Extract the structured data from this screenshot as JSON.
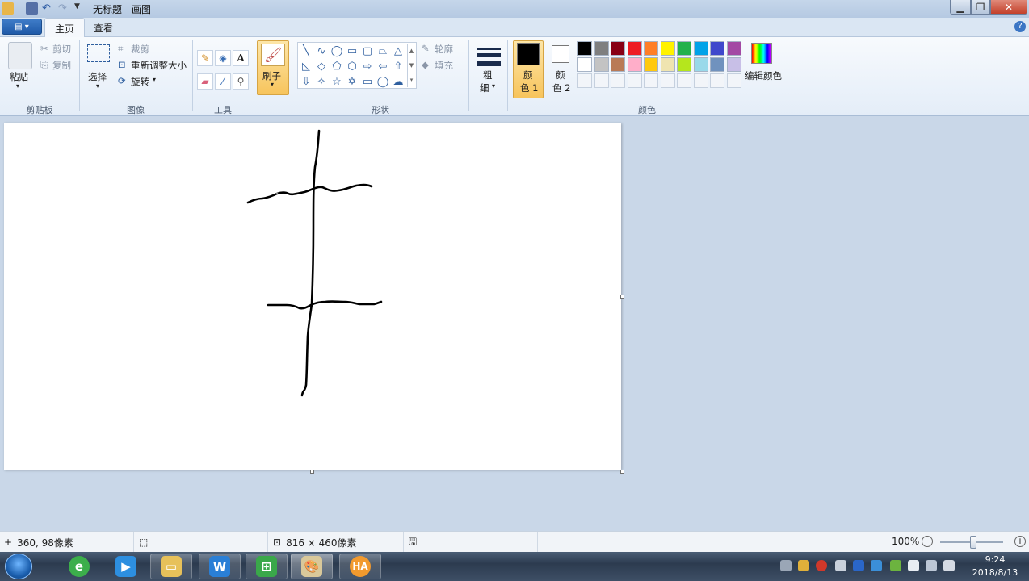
{
  "window": {
    "title": "无标题 - 画图"
  },
  "tabs": {
    "home": "主页",
    "view": "查看"
  },
  "ribbon": {
    "clipboard": {
      "paste": "粘贴",
      "cut": "剪切",
      "copy": "复制",
      "label": "剪贴板"
    },
    "image": {
      "select": "选择",
      "crop": "裁剪",
      "resize": "重新调整大小",
      "rotate": "旋转",
      "label": "图像"
    },
    "tools": {
      "label": "工具",
      "text_tool": "A"
    },
    "brush": {
      "label": "刷子"
    },
    "shapes": {
      "outline": "轮廓",
      "fill": "填充",
      "label": "形状"
    },
    "size": {
      "label_line1": "粗",
      "label_line2": "细"
    },
    "colors": {
      "color1_line1": "颜",
      "color1_line2": "色 1",
      "color2_line1": "颜",
      "color2_line2": "色 2",
      "edit": "编辑颜色",
      "label": "颜色",
      "color1": "#000000",
      "color2": "#ffffff",
      "palette_row1": [
        "#000000",
        "#7f7f7f",
        "#880015",
        "#ed1c24",
        "#ff7f27",
        "#fff200",
        "#22b14c",
        "#00a2e8",
        "#3f48cc",
        "#a349a4"
      ],
      "palette_row2": [
        "#ffffff",
        "#c3c3c3",
        "#b97a57",
        "#ffaec9",
        "#ffc90e",
        "#efe4b0",
        "#b5e61d",
        "#99d9ea",
        "#7092be",
        "#c8bfe7"
      ]
    }
  },
  "status": {
    "cursor_pos": "360, 98像素",
    "canvas_size": "816 × 460像素",
    "zoom": "100%"
  },
  "taskbar": {
    "hao_label": "HA",
    "time": "9:24",
    "date": "2018/8/13"
  }
}
